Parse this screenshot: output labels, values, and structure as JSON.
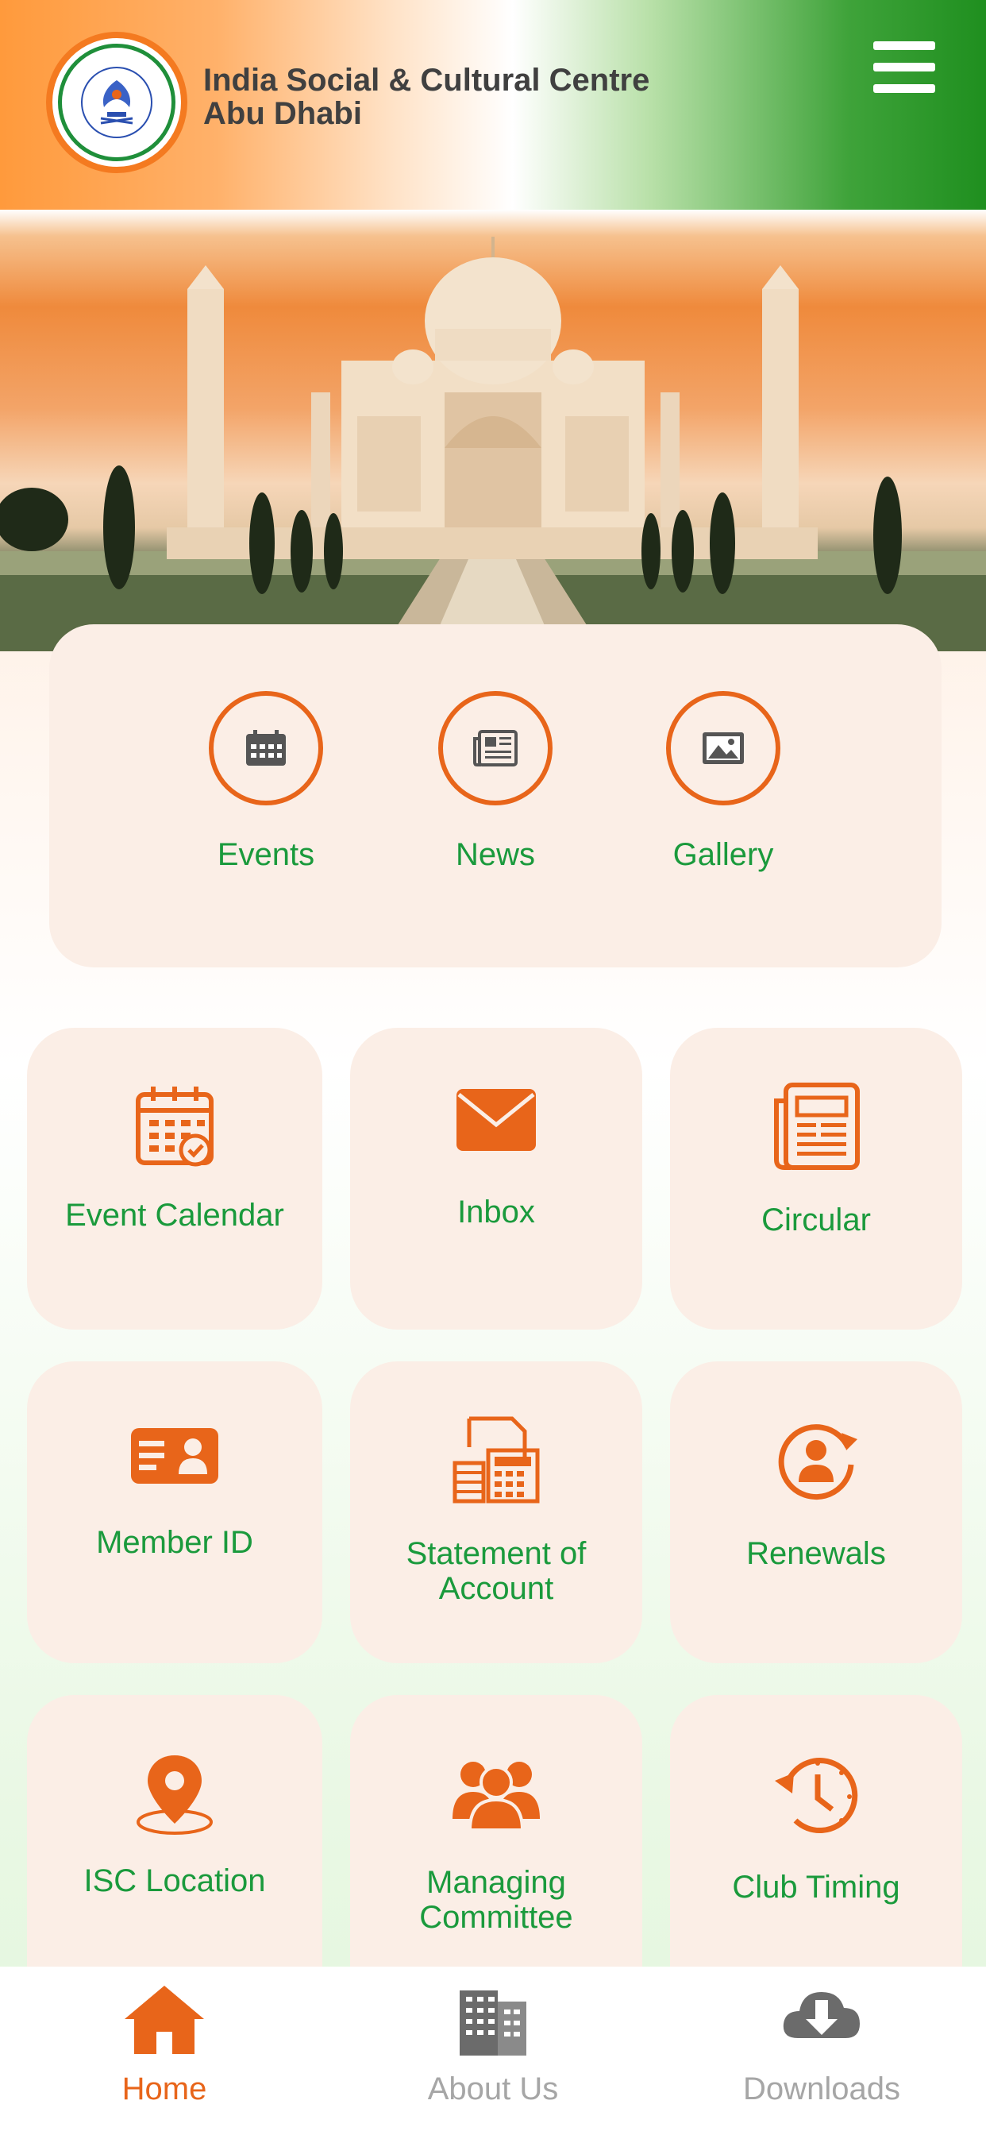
{
  "header": {
    "title_line1": "India Social & Cultural Centre",
    "title_line2": "Abu Dhabi"
  },
  "quick_links": [
    {
      "label": "Events",
      "icon": "calendar-icon"
    },
    {
      "label": "News",
      "icon": "newspaper-icon"
    },
    {
      "label": "Gallery",
      "icon": "image-icon"
    }
  ],
  "tiles": {
    "event_calendar": "Event Calendar",
    "inbox": "Inbox",
    "circular": "Circular",
    "member_id": "Member ID",
    "statement_line1": "Statement of",
    "statement_line2": "Account",
    "renewals": "Renewals",
    "isc_location": "ISC Location",
    "managing_line1": "Managing",
    "managing_line2": "Committee",
    "club_timing": "Club Timing"
  },
  "bottom_nav": [
    {
      "label": "Home",
      "icon": "home-icon",
      "active": true
    },
    {
      "label": "About Us",
      "icon": "building-icon",
      "active": false
    },
    {
      "label": "Downloads",
      "icon": "cloud-download-icon",
      "active": false
    }
  ],
  "colors": {
    "accent_orange": "#e8651a",
    "label_green": "#1a9a3c",
    "inactive_gray": "#a6a6a6"
  }
}
